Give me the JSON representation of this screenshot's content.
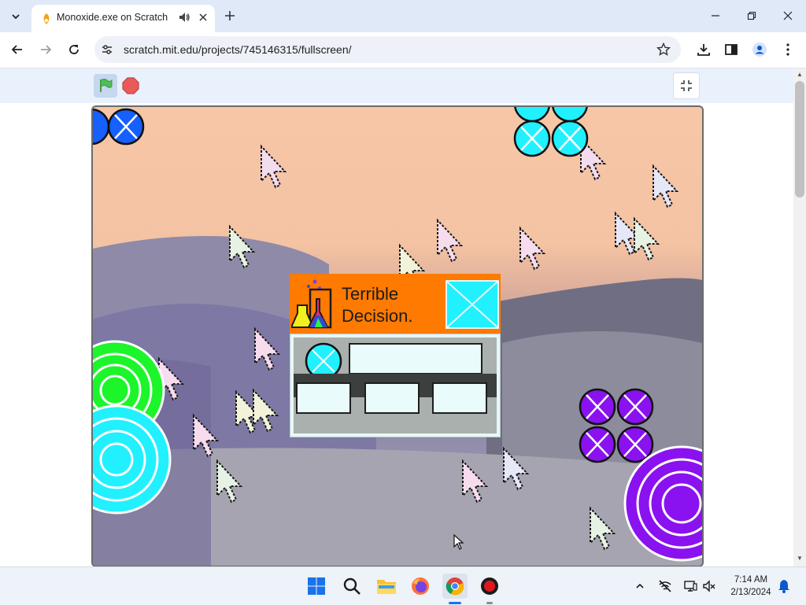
{
  "browser": {
    "tab": {
      "title": "Monoxide.exe on Scratch",
      "audio_icon": "speaker-icon",
      "close_icon": "close-icon"
    },
    "new_tab_icon": "plus-icon",
    "url": "scratch.mit.edu/projects/745146315/fullscreen/",
    "window_controls": [
      "minimize-icon",
      "restore-icon",
      "close-icon"
    ],
    "toolbar_icons": [
      "download-icon",
      "side-panel-icon",
      "profile-icon",
      "kebab-menu-icon"
    ]
  },
  "scratch": {
    "green_flag_icon": "green-flag-icon",
    "stop_icon": "stop-sign-icon",
    "exit_fullscreen_icon": "exit-fullscreen-icon",
    "dialog": {
      "title": "Terrible\nDecision.",
      "icon": "chemistry-flasks-icon"
    }
  },
  "taskbar": {
    "apps": [
      "windows-start-icon",
      "search-icon",
      "file-explorer-icon",
      "firefox-icon",
      "chrome-icon",
      "record-icon"
    ],
    "time": "7:14 AM",
    "date": "2/13/2024",
    "tray_icons": [
      "chevron-up-icon",
      "network-off-icon",
      "display-icon",
      "volume-muted-icon",
      "notification-bell-icon"
    ]
  },
  "colors": {
    "titlebar": "#dfe9f8",
    "dialog_header": "#ff7a00",
    "circle_blue": "#1560ff",
    "circle_cyan": "#21f0ff",
    "circle_purple": "#8a12f0",
    "circle_green": "#1cf52a"
  }
}
